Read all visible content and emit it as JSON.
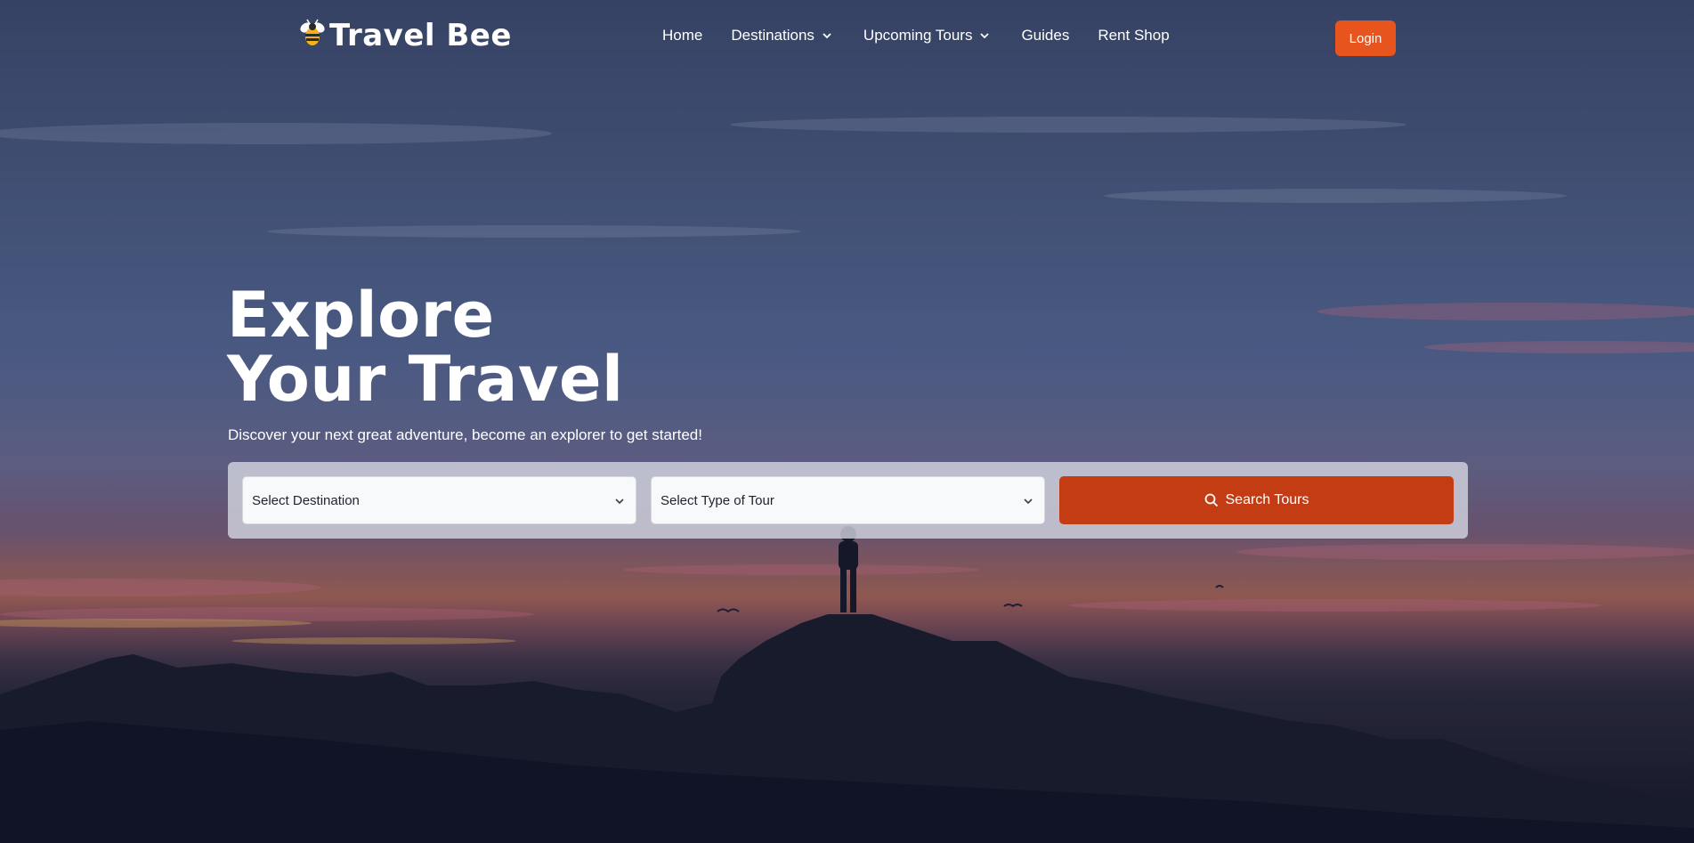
{
  "brand": {
    "name": "Travel Bee",
    "icon": "bee-icon"
  },
  "nav": {
    "items": [
      {
        "label": "Home",
        "icon": null
      },
      {
        "label": "Destinations",
        "icon": "chevron-down-icon"
      },
      {
        "label": "Upcoming Tours",
        "icon": "chevron-down-icon"
      },
      {
        "label": "Guides",
        "icon": null
      },
      {
        "label": "Rent Shop",
        "icon": null
      }
    ],
    "login_label": "Login"
  },
  "hero": {
    "title_line1": "Explore",
    "title_line2": "Your Travel",
    "subtitle": "Discover your next great adventure, become an explorer to get started!"
  },
  "search": {
    "destination": {
      "value": "Select Destination",
      "icon": "chevron-down-icon"
    },
    "tour_type": {
      "value": "Select Type of Tour",
      "icon": "chevron-down-icon"
    },
    "button_label": "Search Tours",
    "button_icon": "search-icon"
  },
  "colors": {
    "accent": "#e8541e",
    "search_button": "#c43c14"
  }
}
